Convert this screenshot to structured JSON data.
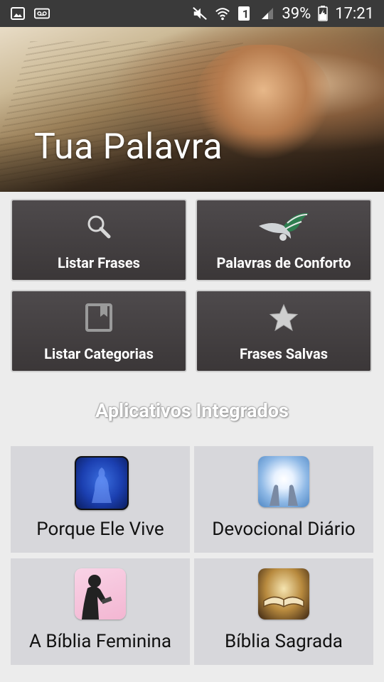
{
  "status_bar": {
    "battery": "39%",
    "time": "17:21",
    "sim_slot": "1",
    "icons": [
      "gallery-icon",
      "voicemail-icon",
      "mute-icon",
      "wifi-icon",
      "sim-icon",
      "signal-icon",
      "battery-icon"
    ]
  },
  "header": {
    "title": "Tua Palavra"
  },
  "menu": {
    "items": [
      {
        "label": "Listar Frases",
        "icon": "search-icon"
      },
      {
        "label": "Palavras de Conforto",
        "icon": "dove-icon"
      },
      {
        "label": "Listar Categorias",
        "icon": "bookmark-icon"
      },
      {
        "label": "Frases Salvas",
        "icon": "star-icon"
      }
    ]
  },
  "integrated": {
    "title": "Aplicativos Integrados",
    "apps": [
      {
        "label": "Porque Ele Vive",
        "icon": "praying-figure-icon"
      },
      {
        "label": "Devocional Diário",
        "icon": "raised-hands-icon"
      },
      {
        "label": "A Bíblia Feminina",
        "icon": "woman-reading-icon"
      },
      {
        "label": "Bíblia Sagrada",
        "icon": "open-bible-icon"
      }
    ]
  },
  "colors": {
    "status_bar": "#3a3a3a",
    "tile_dark": "#433f40",
    "app_tile": "#d7d7db",
    "page_bg": "#ececec"
  }
}
